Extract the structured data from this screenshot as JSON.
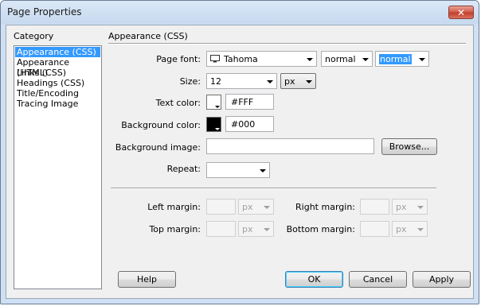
{
  "window": {
    "title": "Page Properties",
    "close_glyph": "✕"
  },
  "category": {
    "label": "Category",
    "items": [
      "Appearance (CSS)",
      "Appearance (HTML)",
      "Links (CSS)",
      "Headings (CSS)",
      "Title/Encoding",
      "Tracing Image"
    ],
    "selected_index": 0
  },
  "section": {
    "title": "Appearance (CSS)"
  },
  "page_font": {
    "label": "Page font:",
    "value": "Tahoma",
    "style": "normal",
    "weight": "normal"
  },
  "size": {
    "label": "Size:",
    "value": "12",
    "unit": "px"
  },
  "text_color": {
    "label": "Text color:",
    "value": "#FFF",
    "swatch": "#ffffff"
  },
  "background_color": {
    "label": "Background color:",
    "value": "#000",
    "swatch": "#000000"
  },
  "background_image": {
    "label": "Background image:",
    "value": "",
    "browse_label": "Browse..."
  },
  "repeat": {
    "label": "Repeat:",
    "value": ""
  },
  "margins": {
    "left_label": "Left margin:",
    "left_unit": "px",
    "right_label": "Right margin:",
    "right_unit": "px",
    "top_label": "Top margin:",
    "top_unit": "px",
    "bottom_label": "Bottom margin:",
    "bottom_unit": "px"
  },
  "buttons": {
    "help": "Help",
    "ok": "OK",
    "cancel": "Cancel",
    "apply": "Apply"
  },
  "colors": {
    "selection": "#3399ff",
    "title_bg": "#cfe0f4",
    "close": "#c94d3a"
  },
  "icons": {
    "font_icon": "monitor-icon",
    "close_icon": "close-icon"
  }
}
